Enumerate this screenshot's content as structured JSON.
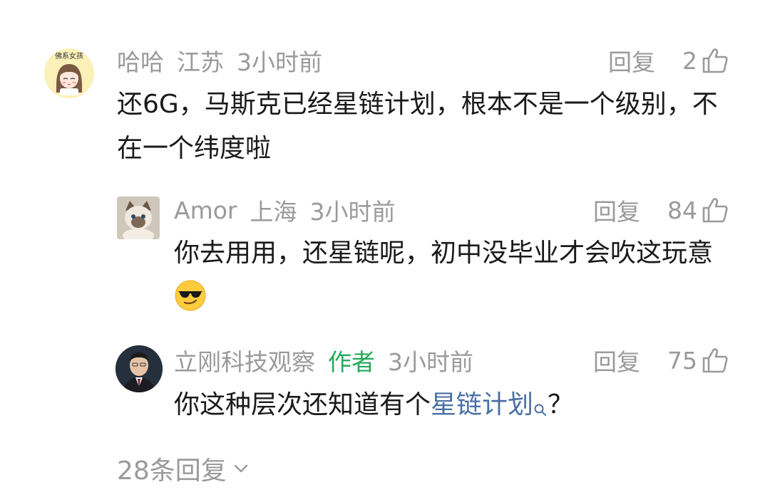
{
  "comments": [
    {
      "user": "哈哈",
      "location": "江苏",
      "time": "3小时前",
      "reply_label": "回复",
      "likes": "2",
      "avatar_icon": "girl-cartoon-avatar",
      "avatar_text": "佛系女孩",
      "text": "还6G，马斯克已经星链计划，根本不是一个级别，不在一个纬度啦"
    },
    {
      "user": "Amor",
      "location": "上海",
      "time": "3小时前",
      "reply_label": "回复",
      "likes": "84",
      "avatar_icon": "cat-photo-avatar",
      "text": "你去用用，还星链呢，初中没毕业才会吹这玩意",
      "emoji": "sunglasses-face-emoji"
    },
    {
      "user": "立刚科技观察",
      "badge": "作者",
      "time": "3小时前",
      "reply_label": "回复",
      "likes": "75",
      "avatar_icon": "man-photo-avatar",
      "text_before": "你这种层次还知道有个",
      "link_text": "星链计划",
      "text_after": "？"
    }
  ],
  "more_replies": "28条回复",
  "colors": {
    "meta_gray": "#9a9a9a",
    "author_green": "#22a95a",
    "link_blue": "#4a6fa5",
    "text": "#1a1a1a"
  }
}
